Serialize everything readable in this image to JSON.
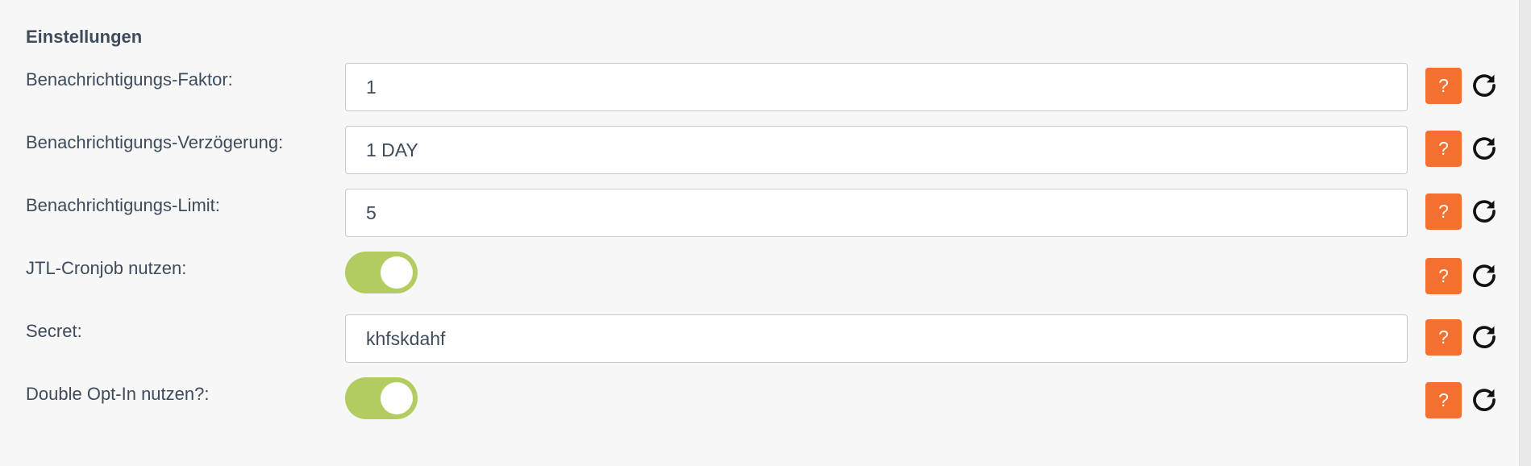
{
  "section": {
    "title": "Einstellungen"
  },
  "settings": [
    {
      "label": "Benachrichtigungs-Faktor:",
      "type": "text",
      "value": "1"
    },
    {
      "label": "Benachrichtigungs-Verzögerung:",
      "type": "text",
      "value": "1 DAY"
    },
    {
      "label": "Benachrichtigungs-Limit:",
      "type": "text",
      "value": "5"
    },
    {
      "label": "JTL-Cronjob nutzen:",
      "type": "toggle",
      "checked": true
    },
    {
      "label": "Secret:",
      "type": "text",
      "value": "khfskdahf"
    },
    {
      "label": "Double Opt-In nutzen?:",
      "type": "toggle",
      "checked": true
    }
  ],
  "buttons": {
    "help_label": "?"
  },
  "icons": {
    "help": "question-mark-icon",
    "reset": "reset-icon"
  },
  "colors": {
    "help_button": "#f37030",
    "toggle_on": "#b2cc62",
    "text": "#3e4b5b"
  }
}
